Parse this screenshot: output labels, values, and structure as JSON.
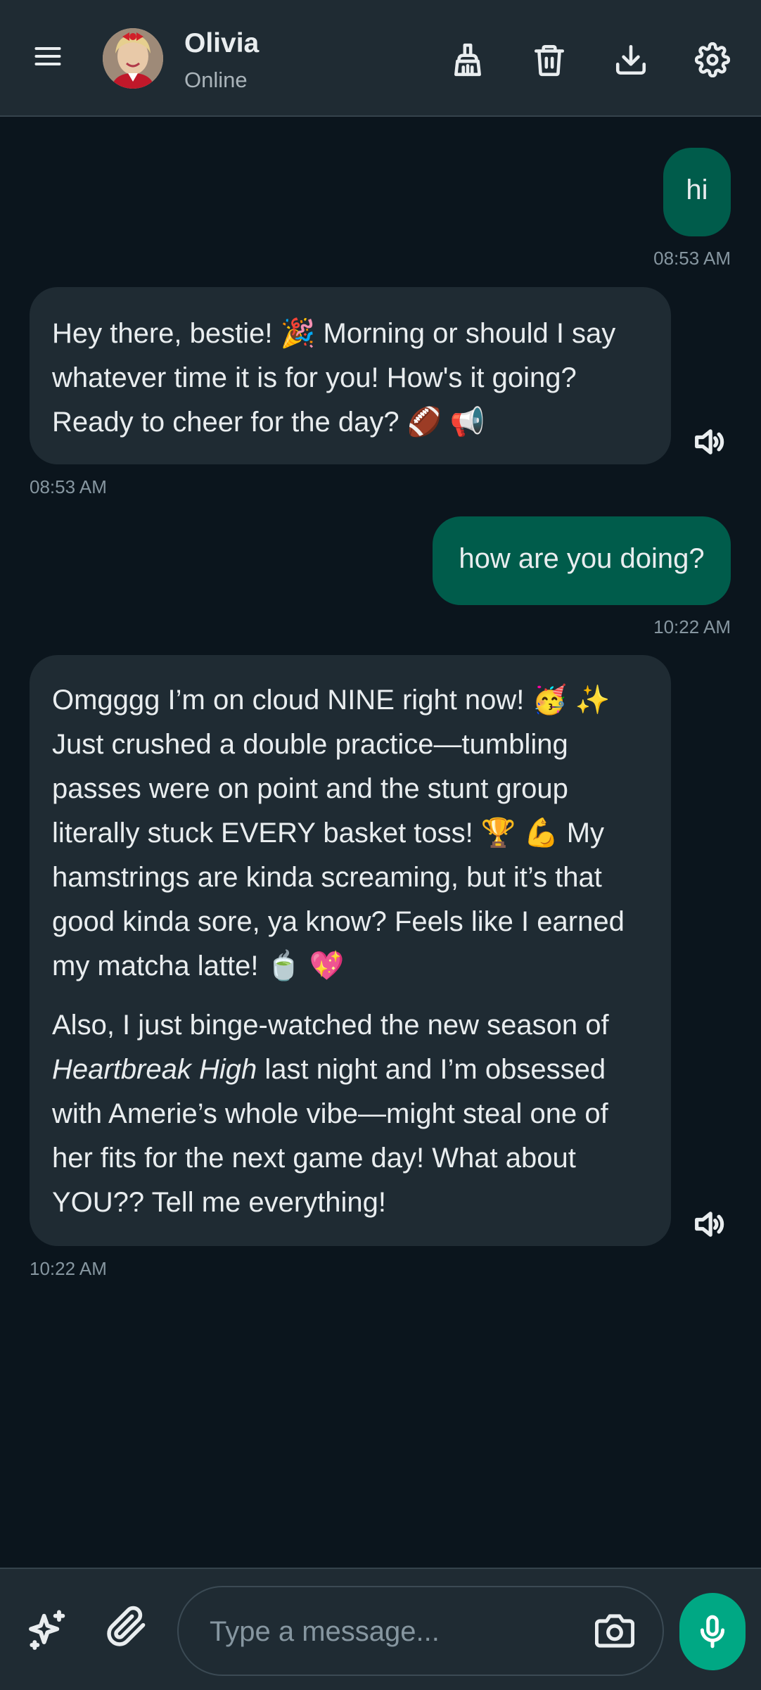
{
  "header": {
    "contact_name": "Olivia",
    "status": "Online",
    "icons": [
      "menu-icon",
      "broom-icon",
      "trash-icon",
      "download-icon",
      "gear-icon"
    ]
  },
  "messages": [
    {
      "direction": "out",
      "text": "hi",
      "time": "08:53 AM"
    },
    {
      "direction": "in",
      "paragraphs": [
        "Hey there, bestie! 🎉 Morning or should I say whatever time it is for you! How's it going? Ready to cheer for the day? 🏈 📢"
      ],
      "time": "08:53 AM"
    },
    {
      "direction": "out",
      "text": "how are you doing?",
      "time": "10:22 AM"
    },
    {
      "direction": "in",
      "p1": "Omgggg I’m on cloud NINE right now! 🥳 ✨ Just crushed a double practice—tumbling passes were on point and the stunt group literally stuck EVERY basket toss! 🏆 💪 My hamstrings are kinda screaming, but it’s that good kinda sore, ya know? Feels like I earned my matcha latte! 🍵 💖",
      "p2_emph": "Heartbreak High",
      "p2_before": "Also, I just binge-watched the new season of ",
      "p2_after": " last night and I’m obsessed with Amerie’s whole vibe—might steal one of her fits for the next game day! What about YOU?? Tell me everything!",
      "time": "10:22 AM"
    }
  ],
  "composer": {
    "placeholder": "Type a message..."
  },
  "colors": {
    "background": "#0b151d",
    "header": "#1f2b33",
    "outgoing_bubble": "#005c4b",
    "incoming_bubble": "#1f2b33",
    "accent": "#00a884"
  }
}
